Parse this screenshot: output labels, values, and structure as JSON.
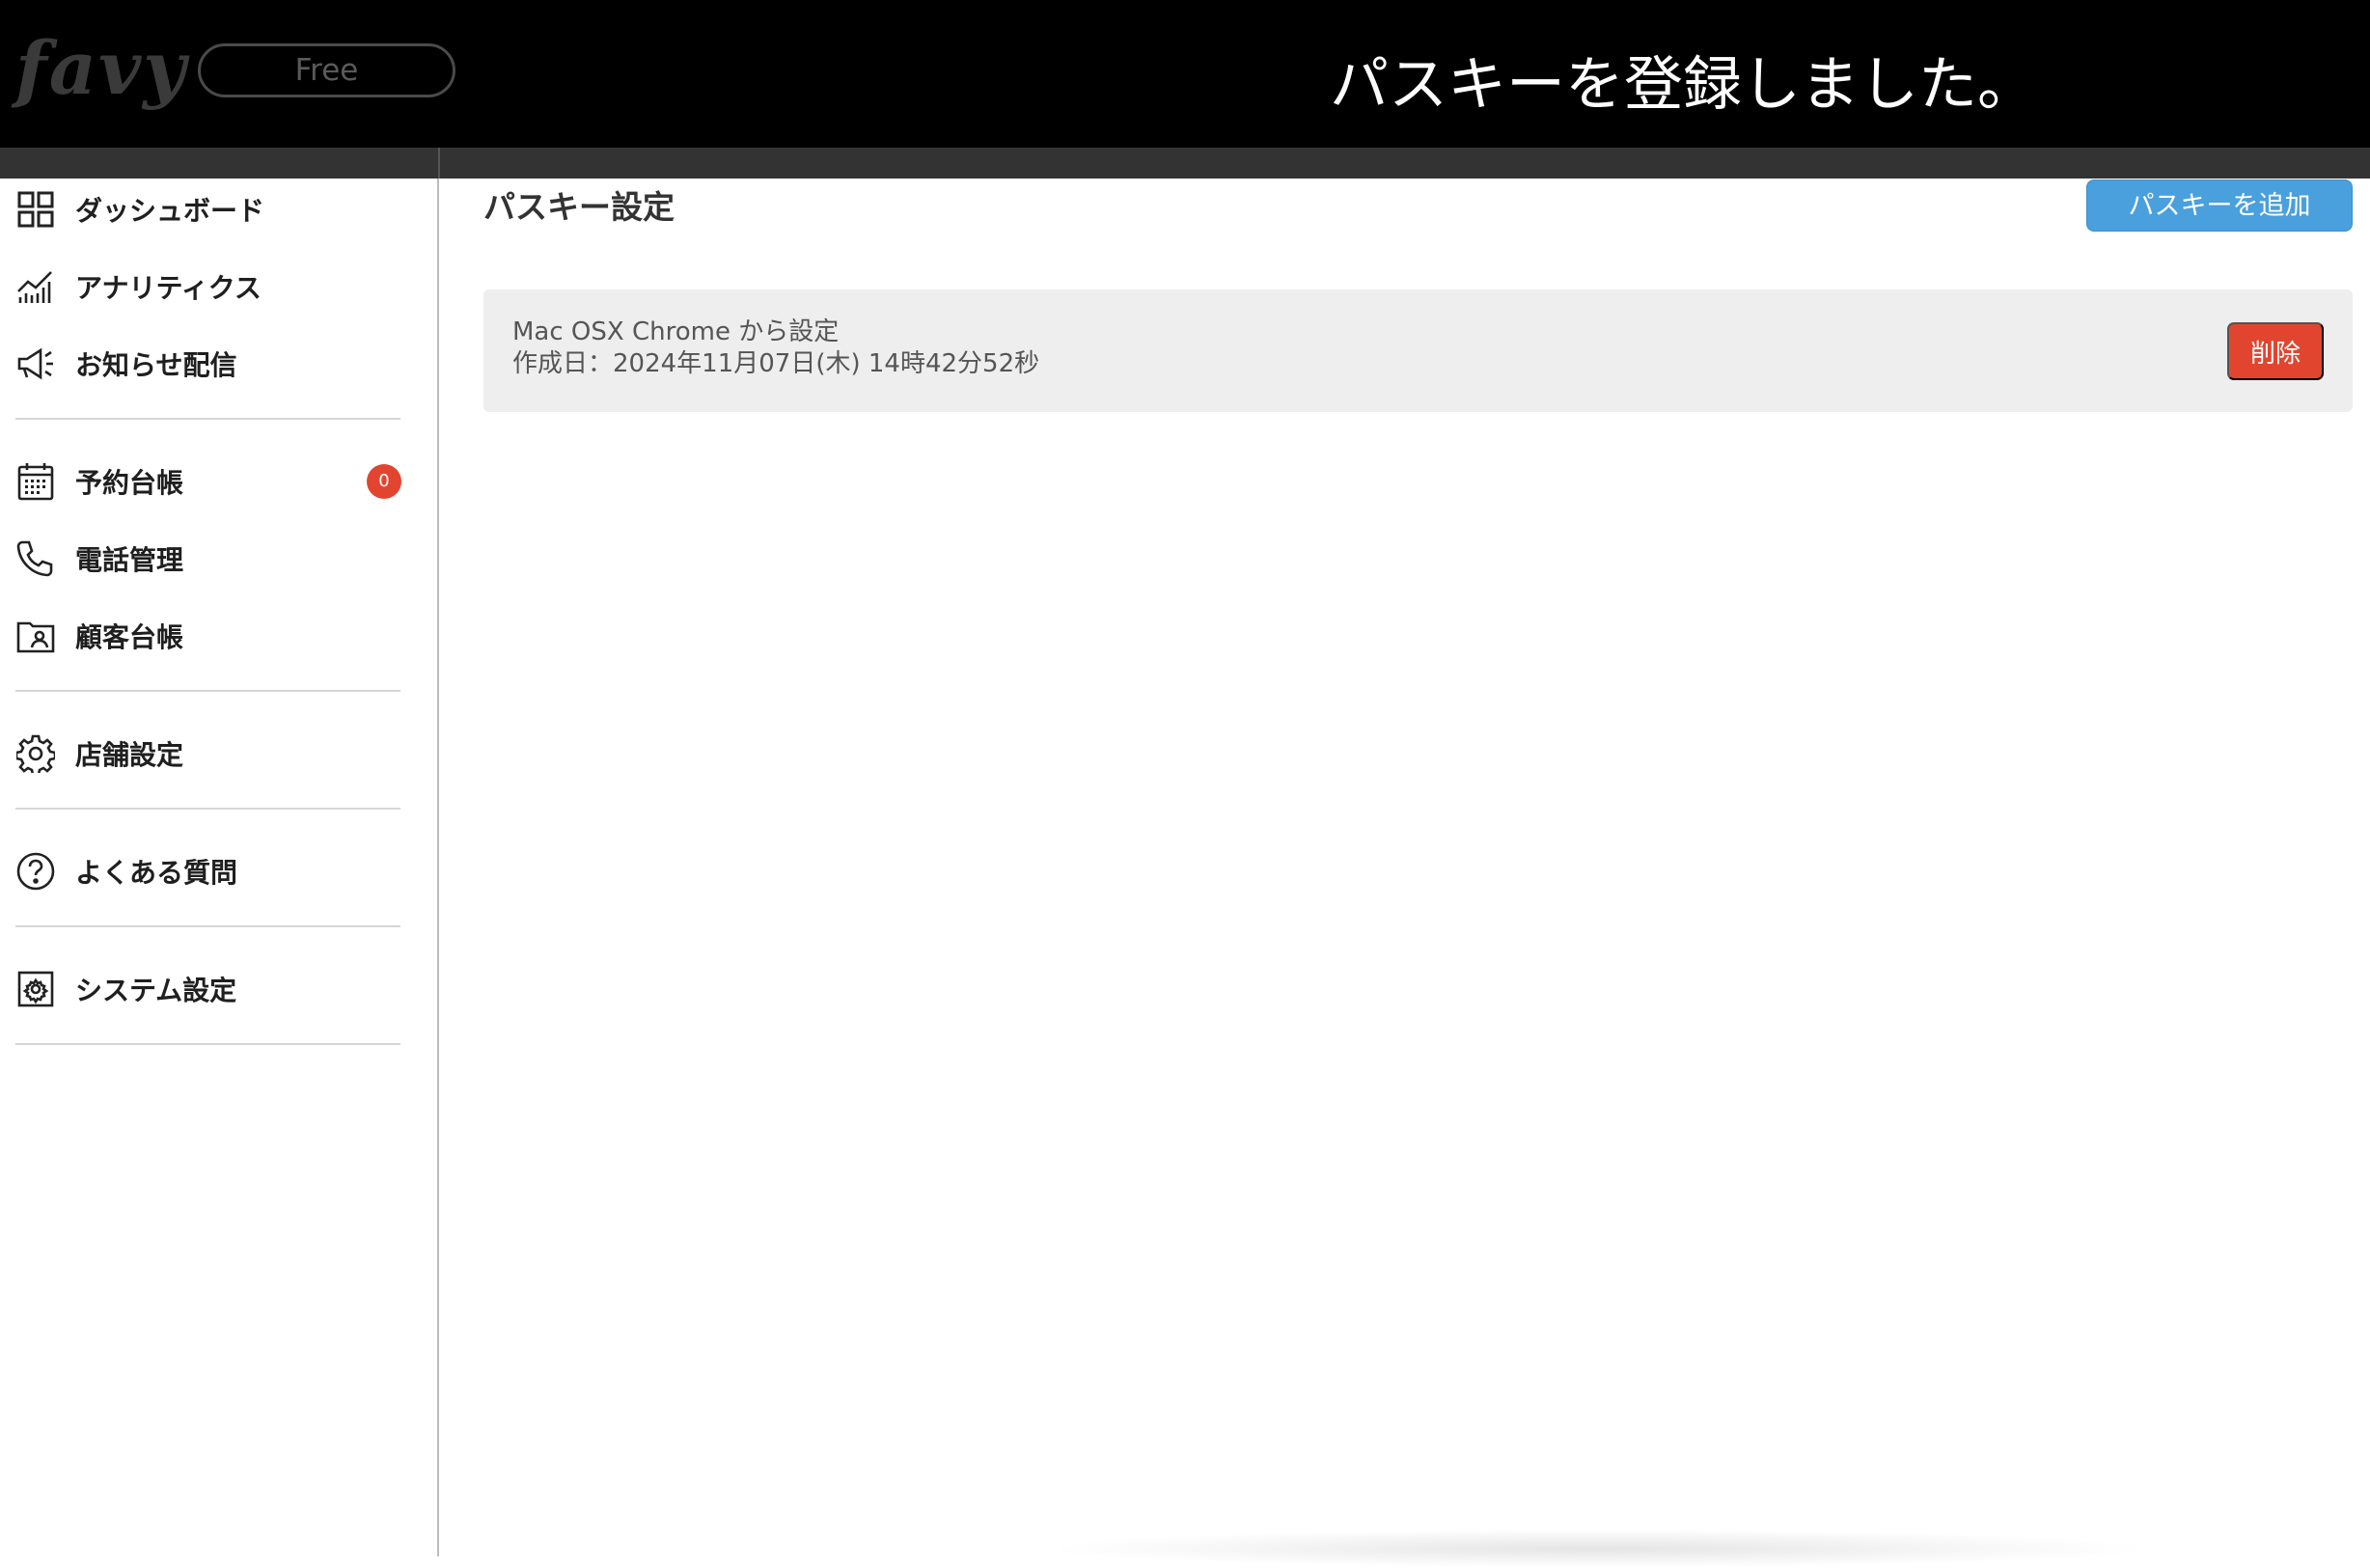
{
  "header": {
    "logo_text": "favy",
    "plan_label": "Free",
    "toast_message": "パスキーを登録しました。"
  },
  "sidebar": {
    "items": [
      {
        "label": "ダッシュボード",
        "icon": "grid-icon"
      },
      {
        "label": "アナリティクス",
        "icon": "analytics-chart-icon"
      },
      {
        "label": "お知らせ配信",
        "icon": "megaphone-icon"
      },
      {
        "label": "予約台帳",
        "icon": "calendar-icon",
        "badge": "0"
      },
      {
        "label": "電話管理",
        "icon": "phone-icon"
      },
      {
        "label": "顧客台帳",
        "icon": "customer-folder-icon"
      },
      {
        "label": "店舗設定",
        "icon": "gear-icon"
      },
      {
        "label": "よくある質問",
        "icon": "question-circle-icon"
      },
      {
        "label": "システム設定",
        "icon": "system-settings-icon"
      }
    ]
  },
  "main": {
    "title": "パスキー設定",
    "add_button_label": "パスキーを追加",
    "passkeys": [
      {
        "name": "Mac OSX Chrome から設定",
        "created": "作成日：2024年11月07日(木) 14時42分52秒",
        "delete_label": "削除"
      }
    ]
  },
  "colors": {
    "header_bg": "#000000",
    "primary_button": "#4a9fdd",
    "danger_button": "#e2452f",
    "badge": "#e2452f",
    "card_bg": "#eeeeee"
  }
}
